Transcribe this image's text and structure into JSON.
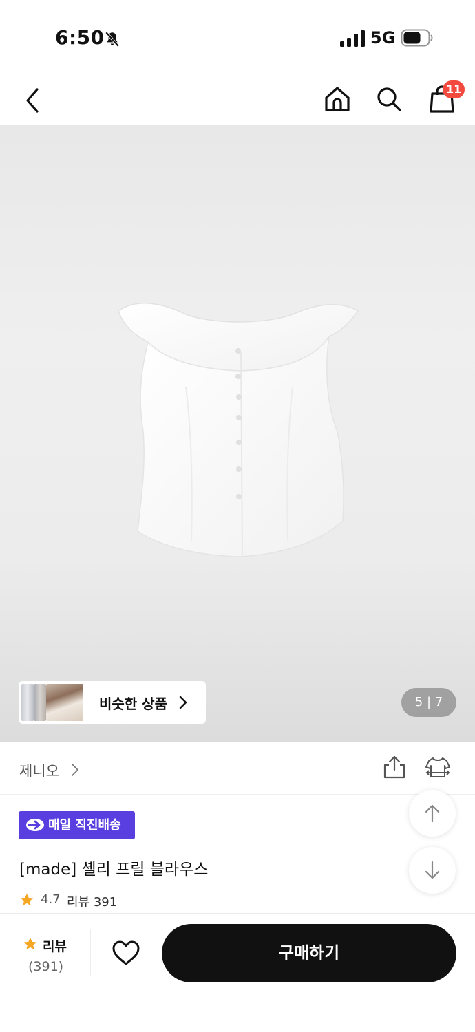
{
  "status_bar": {
    "time": "6:50",
    "network": "5G"
  },
  "nav": {
    "cart_count": "11",
    "icons": [
      "back-icon",
      "home-icon",
      "search-icon",
      "shopping-bag-icon"
    ]
  },
  "gallery": {
    "similar_products_label": "비슷한 상품",
    "page_current": "5",
    "page_total": "7",
    "page_indicator": "5 | 7"
  },
  "brand": {
    "name": "제니오"
  },
  "product": {
    "delivery_badge": "매일 직진배송",
    "title": "[made] 셸리 프릴 블라우스",
    "rating": "4.7",
    "review_link": "리뷰 391"
  },
  "bottom_bar": {
    "review_label": "리뷰",
    "review_count": "(391)",
    "buy_label": "구매하기"
  },
  "colors": {
    "badge_purple": "#5a3fe0",
    "cart_badge_red": "#f24a3e",
    "star_orange": "#f5a623",
    "buy_button": "#111111"
  }
}
